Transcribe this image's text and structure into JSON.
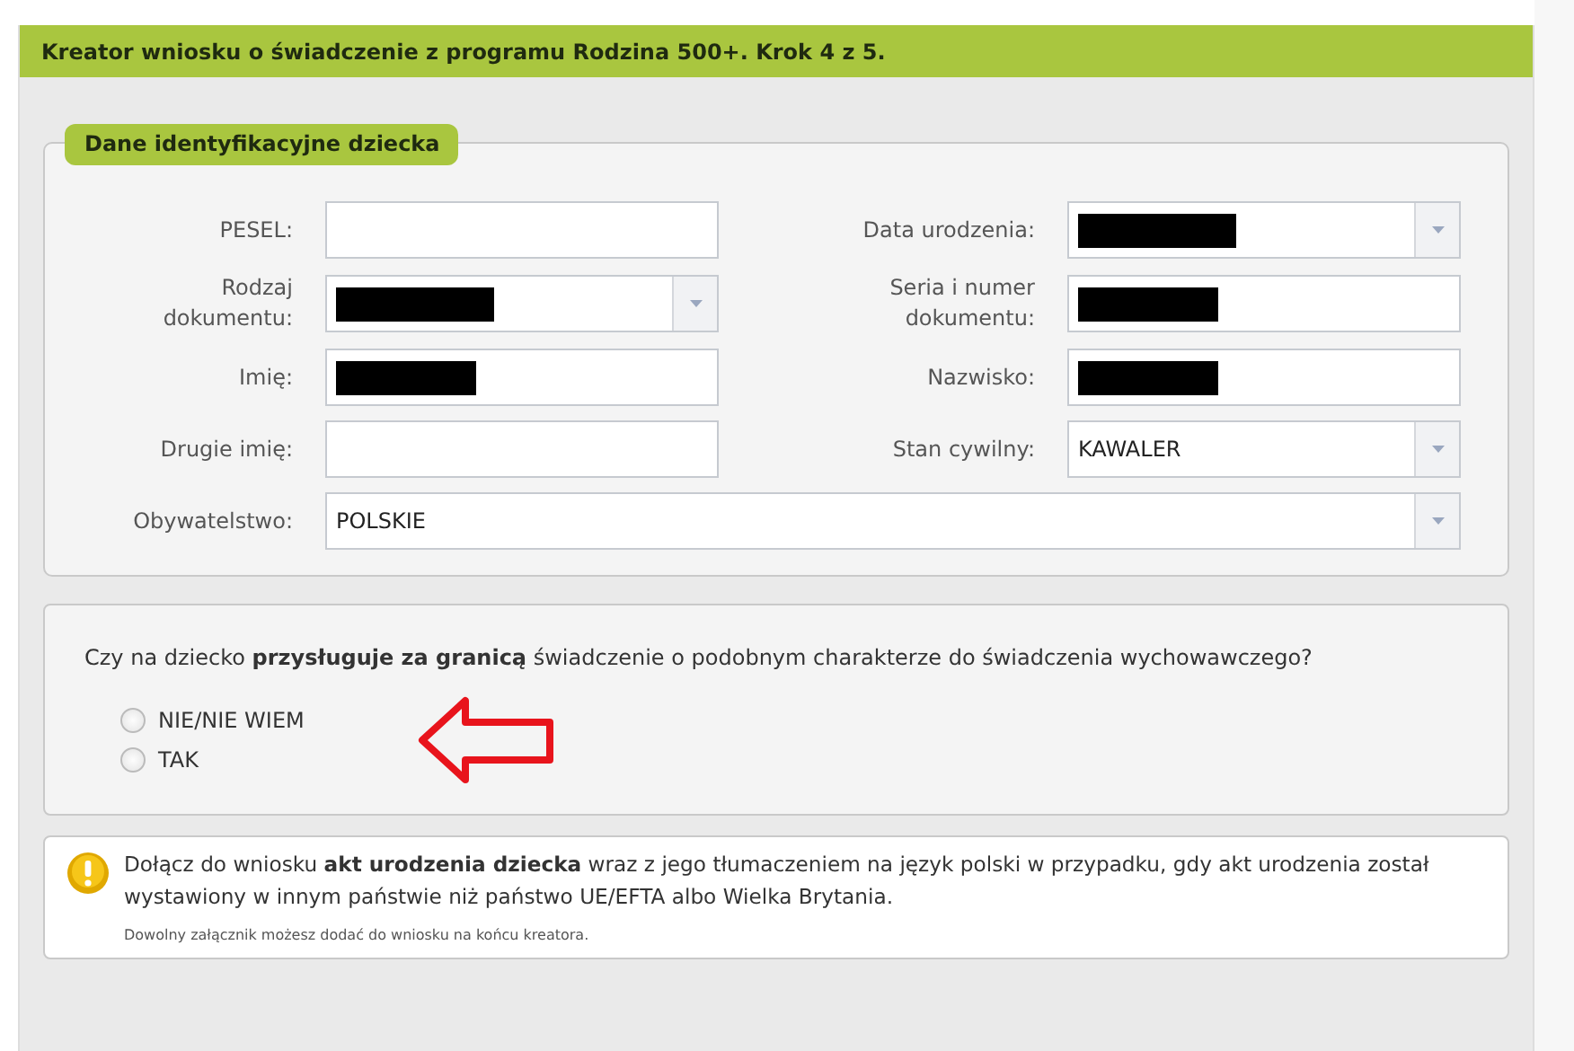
{
  "header": {
    "title": "Kreator wniosku o świadczenie z programu Rodzina 500+. Krok 4 z 5."
  },
  "section": {
    "legend": "Dane identyfikacyjne dziecka",
    "rows": [
      [
        {
          "label": "PESEL:",
          "kind": "text",
          "redacted": false
        },
        {
          "label": "Data urodzenia:",
          "kind": "select",
          "redacted": true
        }
      ],
      [
        {
          "label": "Rodzaj dokumentu:",
          "kind": "select",
          "redacted": true
        },
        {
          "label": "Seria i numer dokumentu:",
          "kind": "text",
          "redacted": true
        }
      ],
      [
        {
          "label": "Imię:",
          "kind": "text",
          "redacted": true
        },
        {
          "label": "Nazwisko:",
          "kind": "text",
          "redacted": true
        }
      ],
      [
        {
          "label": "Drugie imię:",
          "kind": "text",
          "redacted": false
        },
        {
          "label": "Stan cywilny:",
          "kind": "select",
          "value": "KAWALER",
          "redacted": false
        }
      ],
      [
        {
          "label": "Obywatelstwo:",
          "kind": "select",
          "value": "POLSKIE",
          "redacted": false
        }
      ]
    ]
  },
  "question": {
    "text": "Czy na dziecko **przysługuje za granicą** świadczenie o podobnym charakterze do świadczenia wychowawczego?",
    "options": [
      {
        "label": "NIE/NIE WIEM",
        "selected": false
      },
      {
        "label": "TAK",
        "selected": false
      }
    ]
  },
  "notice": {
    "text": "Dołącz do wniosku **akt urodzenia dziecka** wraz z jego tłumaczeniem na język polski w przypadku, gdy akt urodzenia został wystawiony w innym państwie niż państwo UE/EFTA albo Wielka Brytania.",
    "note": "Dowolny załącznik możesz dodać do wniosku na końcu kreatora."
  }
}
